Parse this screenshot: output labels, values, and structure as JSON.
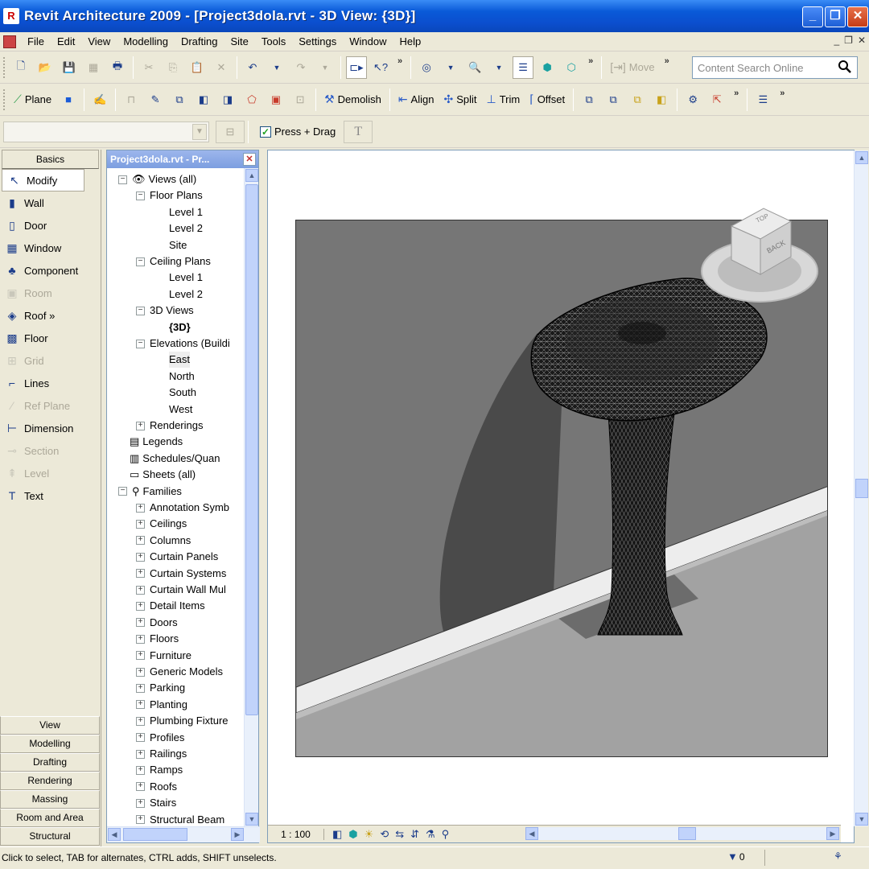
{
  "window": {
    "title": "Revit Architecture 2009 - [Project3dola.rvt - 3D View: {3D}]",
    "app_icon": "R"
  },
  "menu": [
    "File",
    "Edit",
    "View",
    "Modelling",
    "Drafting",
    "Site",
    "Tools",
    "Settings",
    "Window",
    "Help"
  ],
  "toolbar1": {
    "move_label": "Move",
    "search_placeholder": "Content Search Online"
  },
  "toolbar2": {
    "plane_label": "Plane",
    "demolish_label": "Demolish",
    "align_label": "Align",
    "split_label": "Split",
    "trim_label": "Trim",
    "offset_label": "Offset"
  },
  "toolbar3": {
    "press_drag_label": "Press + Drag",
    "press_drag_checked": true
  },
  "design_bar": {
    "header": "Basics",
    "tools": [
      {
        "label": "Modify",
        "icon": "cursor-arrow-icon",
        "glyph": "↖",
        "active": true,
        "enabled": true
      },
      {
        "label": "Wall",
        "icon": "wall-icon",
        "glyph": "▮",
        "enabled": true
      },
      {
        "label": "Door",
        "icon": "door-icon",
        "glyph": "▯",
        "enabled": true
      },
      {
        "label": "Window",
        "icon": "window-icon",
        "glyph": "▦",
        "enabled": true
      },
      {
        "label": "Component",
        "icon": "component-icon",
        "glyph": "♣",
        "enabled": true
      },
      {
        "label": "Room",
        "icon": "room-icon",
        "glyph": "▣",
        "enabled": false
      },
      {
        "label": "Roof »",
        "icon": "roof-icon",
        "glyph": "◈",
        "enabled": true
      },
      {
        "label": "Floor",
        "icon": "floor-icon",
        "glyph": "▩",
        "enabled": true
      },
      {
        "label": "Grid",
        "icon": "grid-icon",
        "glyph": "⊞",
        "enabled": false
      },
      {
        "label": "Lines",
        "icon": "lines-icon",
        "glyph": "⌐",
        "enabled": true
      },
      {
        "label": "Ref Plane",
        "icon": "ref-plane-icon",
        "glyph": "⁄",
        "enabled": false
      },
      {
        "label": "Dimension",
        "icon": "dimension-icon",
        "glyph": "⊢",
        "enabled": true
      },
      {
        "label": "Section",
        "icon": "section-icon",
        "glyph": "⊸",
        "enabled": false
      },
      {
        "label": "Level",
        "icon": "level-icon",
        "glyph": "⇞",
        "enabled": false
      },
      {
        "label": "Text",
        "icon": "text-icon",
        "glyph": "T",
        "enabled": true
      }
    ],
    "tabs": [
      "View",
      "Modelling",
      "Drafting",
      "Rendering",
      "Massing",
      "Room and Area",
      "Structural"
    ]
  },
  "browser": {
    "title": "Project3dola.rvt - Pr...",
    "nodes": [
      {
        "label": "Views (all)",
        "level": 0,
        "toggle": "-",
        "icon": "views-icon",
        "glyph": "👁"
      },
      {
        "label": "Floor Plans",
        "level": 1,
        "toggle": "-"
      },
      {
        "label": "Level 1",
        "level": 2
      },
      {
        "label": "Level 2",
        "level": 2
      },
      {
        "label": "Site",
        "level": 2
      },
      {
        "label": "Ceiling Plans",
        "level": 1,
        "toggle": "-"
      },
      {
        "label": "Level 1",
        "level": 2
      },
      {
        "label": "Level 2",
        "level": 2
      },
      {
        "label": "3D Views",
        "level": 1,
        "toggle": "-"
      },
      {
        "label": "{3D}",
        "level": 2,
        "bold": true
      },
      {
        "label": "Elevations (Buildi",
        "level": 1,
        "toggle": "-"
      },
      {
        "label": "East",
        "level": 2,
        "selected": true
      },
      {
        "label": "North",
        "level": 2
      },
      {
        "label": "South",
        "level": 2
      },
      {
        "label": "West",
        "level": 2
      },
      {
        "label": "Renderings",
        "level": 1,
        "toggle": "+"
      },
      {
        "label": "Legends",
        "level": 0,
        "icon": "legends-icon",
        "glyph": "▤"
      },
      {
        "label": "Schedules/Quan",
        "level": 0,
        "icon": "schedules-icon",
        "glyph": "▥"
      },
      {
        "label": "Sheets (all)",
        "level": 0,
        "icon": "sheets-icon",
        "glyph": "▭"
      },
      {
        "label": "Families",
        "level": 0,
        "toggle": "-",
        "icon": "families-icon",
        "glyph": "⚲"
      },
      {
        "label": "Annotation Symb",
        "level": 1,
        "toggle": "+"
      },
      {
        "label": "Ceilings",
        "level": 1,
        "toggle": "+"
      },
      {
        "label": "Columns",
        "level": 1,
        "toggle": "+"
      },
      {
        "label": "Curtain Panels",
        "level": 1,
        "toggle": "+"
      },
      {
        "label": "Curtain Systems",
        "level": 1,
        "toggle": "+"
      },
      {
        "label": "Curtain Wall Mul",
        "level": 1,
        "toggle": "+"
      },
      {
        "label": "Detail Items",
        "level": 1,
        "toggle": "+"
      },
      {
        "label": "Doors",
        "level": 1,
        "toggle": "+"
      },
      {
        "label": "Floors",
        "level": 1,
        "toggle": "+"
      },
      {
        "label": "Furniture",
        "level": 1,
        "toggle": "+"
      },
      {
        "label": "Generic Models",
        "level": 1,
        "toggle": "+"
      },
      {
        "label": "Parking",
        "level": 1,
        "toggle": "+"
      },
      {
        "label": "Planting",
        "level": 1,
        "toggle": "+"
      },
      {
        "label": "Plumbing Fixture",
        "level": 1,
        "toggle": "+"
      },
      {
        "label": "Profiles",
        "level": 1,
        "toggle": "+"
      },
      {
        "label": "Railings",
        "level": 1,
        "toggle": "+"
      },
      {
        "label": "Ramps",
        "level": 1,
        "toggle": "+"
      },
      {
        "label": "Roofs",
        "level": 1,
        "toggle": "+"
      },
      {
        "label": "Stairs",
        "level": 1,
        "toggle": "+"
      },
      {
        "label": "Structural Beam",
        "level": 1,
        "toggle": "+"
      }
    ]
  },
  "view": {
    "scale": "1 : 100",
    "viewcube_labels": [
      "BACK",
      "TOP"
    ]
  },
  "status": {
    "message": "Click to select, TAB for alternates, CTRL adds, SHIFT unselects.",
    "filter_count": "0"
  },
  "colors": {
    "title_bar": "#0a5ad8",
    "chrome": "#ece9d8",
    "viewport_bg": "#7a7a7a",
    "floor": "#a0a0a0",
    "baseboard": "#eeeeee"
  }
}
